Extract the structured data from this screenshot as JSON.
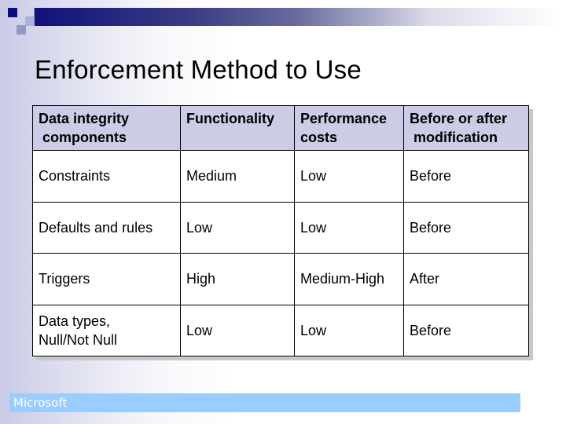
{
  "slide": {
    "title": "Enforcement Method to Use",
    "footer": "Microsoft"
  },
  "table": {
    "headers": [
      [
        "Data integrity",
        " components"
      ],
      [
        "Functionality",
        ""
      ],
      [
        "Performance",
        "costs"
      ],
      [
        "Before or after",
        " modification"
      ]
    ],
    "rows": [
      {
        "component": [
          "Constraints",
          ""
        ],
        "functionality": "Medium",
        "performance": "Low",
        "timing": "Before"
      },
      {
        "component": [
          "Defaults and rules",
          ""
        ],
        "functionality": "Low",
        "performance": "Low",
        "timing": "Before"
      },
      {
        "component": [
          "Triggers",
          ""
        ],
        "functionality": "High",
        "performance": "Medium-High",
        "timing": "After"
      },
      {
        "component": [
          "Data types,",
          "Null/Not Null"
        ],
        "functionality": "Low",
        "performance": "Low",
        "timing": "Before"
      }
    ]
  },
  "colors": {
    "header_fill": "#cccce6",
    "title_bar_dark": "#10127a",
    "footer_fill": "#99ccff"
  }
}
